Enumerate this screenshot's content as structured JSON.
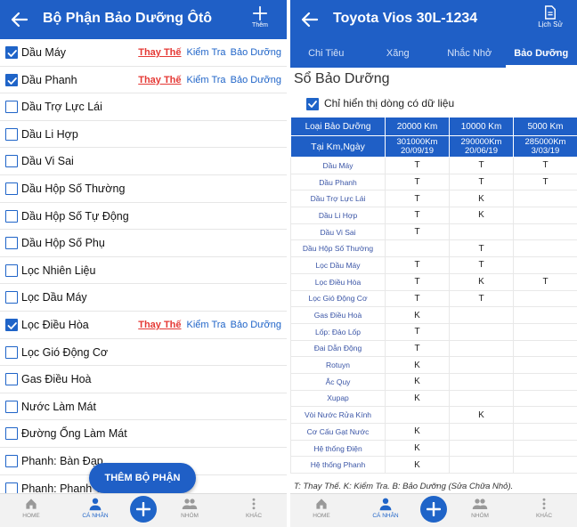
{
  "left": {
    "title": "Bộ Phận Bảo Dưỡng Ôtô",
    "add_label": "Thêm",
    "items": [
      {
        "name": "Dầu Máy",
        "checked": true,
        "replace": "Thay Thế",
        "check": "Kiểm Tra",
        "maintain": "Bảo Dưỡng"
      },
      {
        "name": "Dầu Phanh",
        "checked": true,
        "replace": "Thay Thế",
        "check": "Kiểm Tra",
        "maintain": "Bảo Dưỡng"
      },
      {
        "name": "Dầu Trợ Lực Lái",
        "checked": false
      },
      {
        "name": "Dầu Li Hợp",
        "checked": false
      },
      {
        "name": "Dầu Vi Sai",
        "checked": false
      },
      {
        "name": "Dầu Hộp Số Thường",
        "checked": false
      },
      {
        "name": "Dầu Hộp Số Tự Động",
        "checked": false
      },
      {
        "name": "Dầu Hộp Số Phụ",
        "checked": false
      },
      {
        "name": "Lọc Nhiên Liệu",
        "checked": false
      },
      {
        "name": "Lọc Dầu Máy",
        "checked": false
      },
      {
        "name": "Lọc Điều Hòa",
        "checked": true,
        "replace": "Thay Thế",
        "check": "Kiểm Tra",
        "maintain": "Bảo Dưỡng"
      },
      {
        "name": "Lọc Gió Động Cơ",
        "checked": false
      },
      {
        "name": "Gas Điều Hoà",
        "checked": false
      },
      {
        "name": "Nước Làm Mát",
        "checked": false
      },
      {
        "name": "Đường Ống Làm Mát",
        "checked": false
      },
      {
        "name": "Phanh: Bàn Đạp",
        "checked": false
      },
      {
        "name": "Phanh: Phanh Tay",
        "checked": false
      }
    ],
    "add_part_button": "THÊM BỘ PHẬN",
    "nav": {
      "home": "HOME",
      "personal": "CÁ NHÂN",
      "group": "NHÓM",
      "other": "KHÁC"
    }
  },
  "right": {
    "title": "Toyota Vios 30L-1234",
    "history_label": "Lịch Sử",
    "tabs": [
      "Chi Tiêu",
      "Xăng",
      "Nhắc Nhở",
      "Bảo Dưỡng"
    ],
    "section_title": "Sổ Bảo Dưỡng",
    "filter_label": "Chỉ hiển thị dòng có dữ liệu",
    "table": {
      "header_type": "Loại Bảo Dưỡng",
      "header_at": "Tại Km,Ngày",
      "columns": [
        {
          "km": "20000 Km",
          "odo": "301000Km",
          "date": "20/09/19"
        },
        {
          "km": "10000 Km",
          "odo": "290000Km",
          "date": "20/06/19"
        },
        {
          "km": "5000 Km",
          "odo": "285000Km",
          "date": "3/03/19"
        }
      ],
      "rows": [
        {
          "part": "Dầu Máy",
          "v": [
            "T",
            "T",
            "T"
          ]
        },
        {
          "part": "Dầu Phanh",
          "v": [
            "T",
            "T",
            "T"
          ]
        },
        {
          "part": "Dầu Trợ Lực Lái",
          "v": [
            "T",
            "K",
            ""
          ]
        },
        {
          "part": "Dầu Li Hợp",
          "v": [
            "T",
            "K",
            ""
          ]
        },
        {
          "part": "Dầu Vi Sai",
          "v": [
            "T",
            "",
            ""
          ]
        },
        {
          "part": "Dầu Hộp Số Thường",
          "v": [
            "",
            "T",
            ""
          ]
        },
        {
          "part": "Lọc Dầu Máy",
          "v": [
            "T",
            "T",
            ""
          ]
        },
        {
          "part": "Lọc Điều Hòa",
          "v": [
            "T",
            "K",
            "T"
          ]
        },
        {
          "part": "Lọc Gió Động Cơ",
          "v": [
            "T",
            "T",
            ""
          ]
        },
        {
          "part": "Gas Điều Hoà",
          "v": [
            "K",
            "",
            ""
          ]
        },
        {
          "part": "Lốp: Đảo Lốp",
          "v": [
            "T",
            "",
            ""
          ]
        },
        {
          "part": "Đai Dẫn Động",
          "v": [
            "T",
            "",
            ""
          ]
        },
        {
          "part": "Rotuyn",
          "v": [
            "K",
            "",
            ""
          ]
        },
        {
          "part": "Ắc Quy",
          "v": [
            "K",
            "",
            ""
          ]
        },
        {
          "part": "Xupap",
          "v": [
            "K",
            "",
            ""
          ]
        },
        {
          "part": "Vòi Nước Rửa Kính",
          "v": [
            "",
            "K",
            ""
          ]
        },
        {
          "part": "Cơ Cấu Gạt Nước",
          "v": [
            "K",
            "",
            ""
          ]
        },
        {
          "part": "Hệ thống Điện",
          "v": [
            "K",
            "",
            ""
          ]
        },
        {
          "part": "Hệ thống Phanh",
          "v": [
            "K",
            "",
            ""
          ]
        }
      ]
    },
    "legend": "T: Thay Thế. K: Kiểm Tra. B: Bảo Dưỡng (Sửa Chữa Nhỏ).",
    "nav": {
      "home": "HOME",
      "personal": "CÁ NHÂN",
      "group": "NHÓM",
      "other": "KHÁC"
    }
  },
  "colors": {
    "primary": "#1f5fc6",
    "replace_red": "#e53935",
    "link_blue": "#1f64c8",
    "nav_bg": "#f2f2f2"
  }
}
